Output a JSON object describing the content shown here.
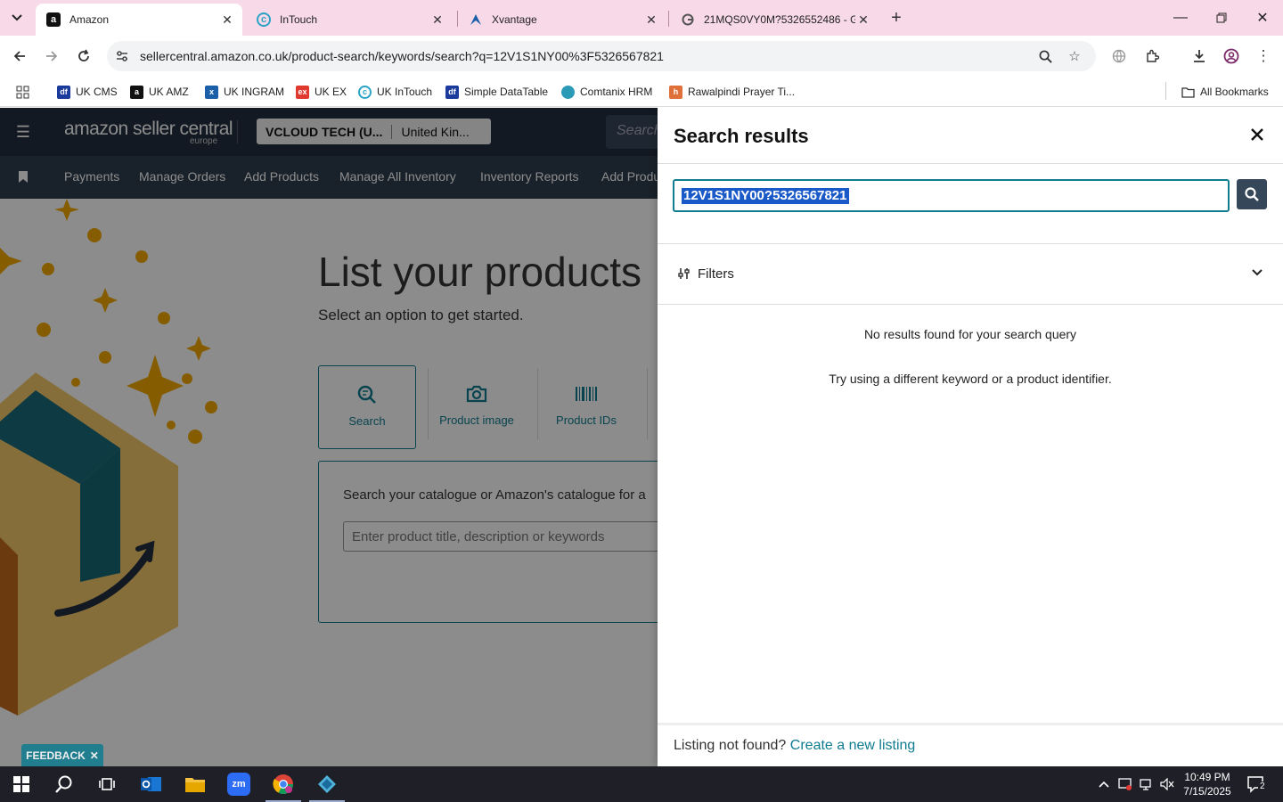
{
  "browser": {
    "tabs": [
      {
        "title": "Amazon",
        "favicon": "amazon-a",
        "active": true
      },
      {
        "title": "InTouch",
        "favicon": "intouch-c",
        "active": false
      },
      {
        "title": "Xvantage",
        "favicon": "xvantage-x",
        "active": false
      },
      {
        "title": "21MQS0VY0M?5326552486 - G",
        "favicon": "google-g",
        "active": false
      }
    ],
    "url": "sellercentral.amazon.co.uk/product-search/keywords/search?q=12V1S1NY00%3F5326567821",
    "bookmarks": [
      {
        "label": "UK CMS",
        "icon": "df"
      },
      {
        "label": "UK AMZ",
        "icon": "a"
      },
      {
        "label": "UK INGRAM",
        "icon": "x"
      },
      {
        "label": "UK EX",
        "icon": "ex"
      },
      {
        "label": "UK InTouch",
        "icon": "c"
      },
      {
        "label": "Simple DataTable",
        "icon": "df"
      },
      {
        "label": "Comtanix HRM",
        "icon": "c"
      },
      {
        "label": "Rawalpindi Prayer Ti...",
        "icon": "h"
      }
    ],
    "all_bookmarks": "All Bookmarks"
  },
  "seller_central": {
    "logo": "amazon seller central",
    "logo_sub": "europe",
    "account": "VCLOUD TECH (U...",
    "marketplace": "United Kin...",
    "search_placeholder": "Search",
    "nav": [
      "Payments",
      "Manage Orders",
      "Add Products",
      "Manage All Inventory",
      "Inventory Reports",
      "Add Produ"
    ]
  },
  "main": {
    "title": "List your products",
    "subtitle": "Select an option to get started.",
    "options": [
      {
        "label": "Search",
        "icon": "search-icon"
      },
      {
        "label": "Product image",
        "icon": "camera-icon"
      },
      {
        "label": "Product IDs",
        "icon": "barcode-icon"
      }
    ],
    "search_label": "Search your catalogue or Amazon's catalogue for a",
    "search_placeholder": "Enter product title, description or keywords",
    "feedback": "FEEDBACK"
  },
  "drawer": {
    "title": "Search results",
    "query": "12V1S1NY00?5326567821",
    "filters_label": "Filters",
    "no_results": "No results found for your search query",
    "try_message": "Try using a different keyword or a product identifier.",
    "footer_text": "Listing not found?",
    "footer_link": "Create a new listing"
  },
  "taskbar": {
    "time": "10:49 PM",
    "date": "7/15/2025",
    "notifications": "2"
  },
  "colors": {
    "teal": "#0f7c90",
    "header": "#232f3e",
    "tabstrip": "#f8d9e7"
  }
}
